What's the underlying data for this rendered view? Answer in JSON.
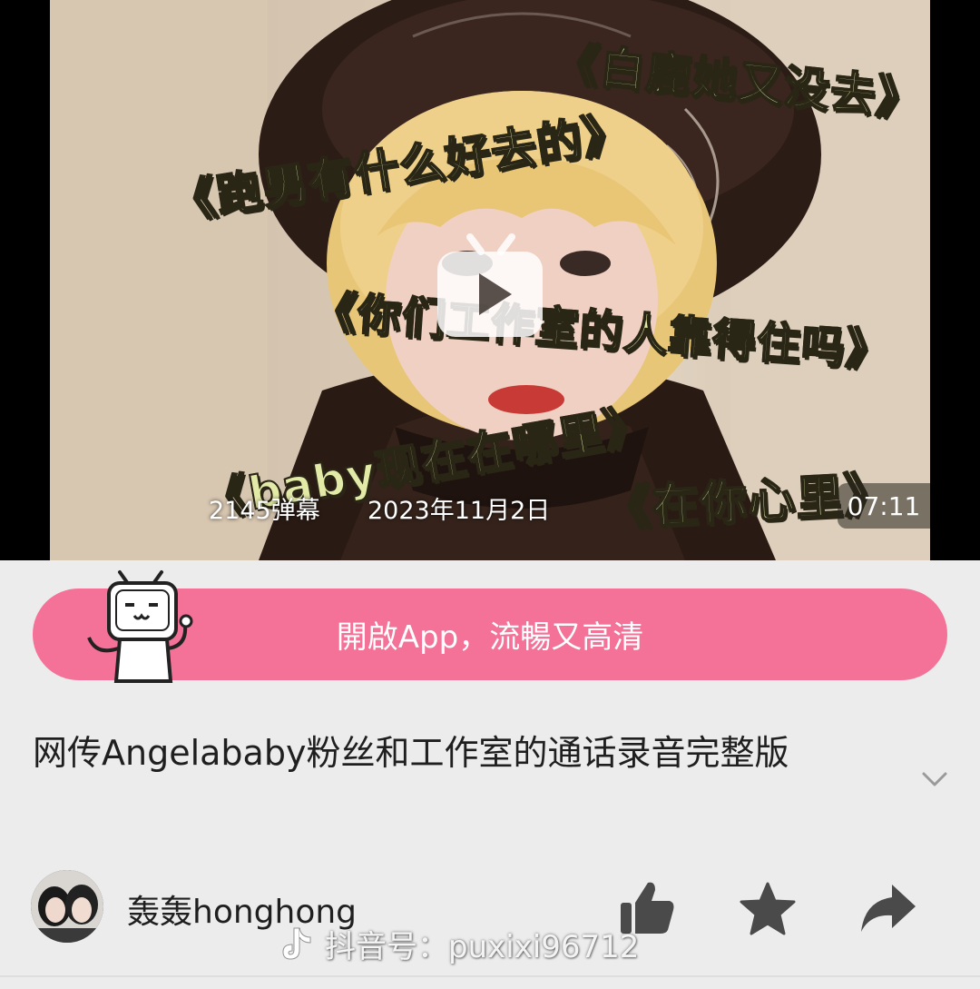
{
  "video": {
    "captions": [
      "《白鹿她又没去》",
      "《跑男有什么好去的》",
      "《你们工作室的人靠得住吗》",
      "《baby现在在哪里》",
      "《在你心里》"
    ],
    "danmaku_count": "2145弹幕",
    "date": "2023年11月2日",
    "duration": "07:11"
  },
  "banner": {
    "open_app_label": "開啟App，流暢又高清"
  },
  "title": {
    "text": " 网传Angelababy粉丝和工作室的通话录音完整版"
  },
  "uploader": {
    "name": "轰轰honghong"
  },
  "watermark": {
    "text": "抖音号：puxixi96712"
  },
  "colors": {
    "accent_pink": "#f47198",
    "caption_yellow": "#e3e9a6",
    "icon_gray": "#4a4a4a"
  },
  "icons": {
    "play": "play-icon",
    "like": "thumbs-up-icon",
    "favorite": "star-icon",
    "share": "share-arrow-icon",
    "expand": "chevron-down-icon"
  }
}
